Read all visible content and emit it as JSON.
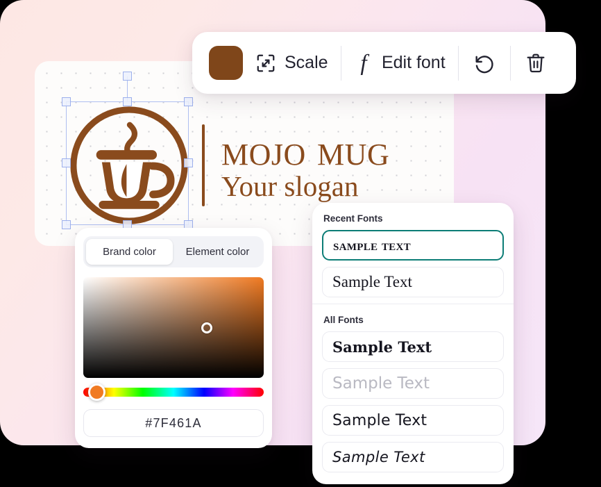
{
  "toolbar": {
    "swatch_color": "#7F461A",
    "swatch_name": "color-swatch",
    "scale_label": "Scale",
    "scale_icon": "scale-icon",
    "edit_font_label": "Edit font",
    "edit_font_icon": "font-f-icon",
    "undo_icon": "undo-icon",
    "delete_icon": "trash-icon"
  },
  "canvas": {
    "logo": {
      "brand_name": "Mojo Mug",
      "slogan": "Your slogan",
      "brand_color": "#8A4B1D",
      "mark_icon": "coffee-cup-circle-icon"
    },
    "selection": {
      "rotate_handle": "rotate-handle"
    }
  },
  "color_panel": {
    "tabs": [
      {
        "label": "Brand color",
        "active": true
      },
      {
        "label": "Element color",
        "active": false
      }
    ],
    "hex_value": "#7F461A",
    "selected_color": "#7F461A",
    "hue_thumb_color": "#F07A22"
  },
  "fonts_panel": {
    "recent_title": "Recent Fonts",
    "all_title": "All Fonts",
    "selected_border_color": "#0C7D76",
    "recent": [
      {
        "label": "Sample Text",
        "style": "ff-smallcaps",
        "selected": true
      },
      {
        "label": "Sample Text",
        "style": "ff-serif",
        "selected": false
      }
    ],
    "all": [
      {
        "label": "Sample Text",
        "style": "ff-slab-bold",
        "selected": false
      },
      {
        "label": "Sample Text",
        "style": "ff-thin",
        "selected": false
      },
      {
        "label": "Sample Text",
        "style": "ff-geo",
        "selected": false
      },
      {
        "label": "Sample Text",
        "style": "ff-script",
        "selected": false
      }
    ]
  }
}
